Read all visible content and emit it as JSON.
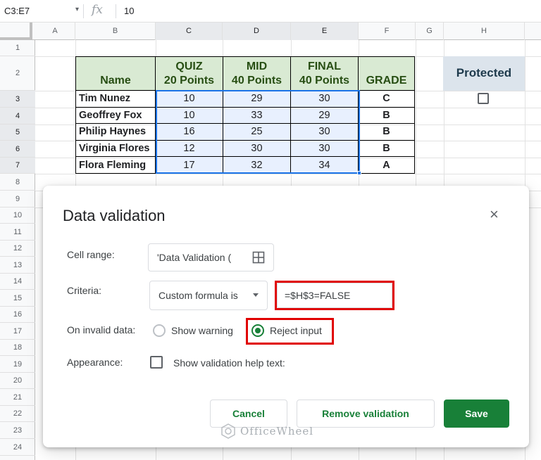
{
  "formula_bar": {
    "name_box": "C3:E7",
    "fx": "fx",
    "value": "10"
  },
  "columns": [
    "A",
    "B",
    "C",
    "D",
    "E",
    "F",
    "G",
    "H"
  ],
  "rows": [
    "1",
    "2",
    "3",
    "4",
    "5",
    "6",
    "7",
    "8",
    "9",
    "10",
    "11",
    "12",
    "13",
    "14",
    "15",
    "16",
    "17",
    "18",
    "19",
    "20",
    "21",
    "22",
    "23",
    "24"
  ],
  "table": {
    "headers": [
      "Name",
      "QUIZ",
      "20 Points",
      "MID",
      "40 Points",
      "FINAL",
      "40 Points",
      "GRADE"
    ],
    "rows": [
      [
        "Tim Nunez",
        "10",
        "29",
        "30",
        "C"
      ],
      [
        "Geoffrey Fox",
        "10",
        "33",
        "29",
        "B"
      ],
      [
        "Philip Haynes",
        "16",
        "25",
        "30",
        "B"
      ],
      [
        "Virginia Flores",
        "12",
        "30",
        "30",
        "B"
      ],
      [
        "Flora Fleming",
        "17",
        "32",
        "34",
        "A"
      ]
    ]
  },
  "protected_label": "Protected",
  "dialog": {
    "title": "Data validation",
    "close": "×",
    "cell_range_label": "Cell range:",
    "cell_range_value": "'Data Validation (",
    "criteria_label": "Criteria:",
    "criteria_value": "Custom formula is",
    "formula_value": "=$H$3=FALSE",
    "invalid_label": "On invalid data:",
    "show_warning": "Show warning",
    "reject_input": "Reject input",
    "appearance_label": "Appearance:",
    "help_text_label": "Show validation help text:",
    "cancel": "Cancel",
    "remove": "Remove validation",
    "save": "Save"
  },
  "watermark": "OfficeWheel",
  "colors": {
    "accent": "#188038",
    "highlight": "#e00000",
    "header_bg": "#d9ead3",
    "selection": "#1a73e8"
  }
}
